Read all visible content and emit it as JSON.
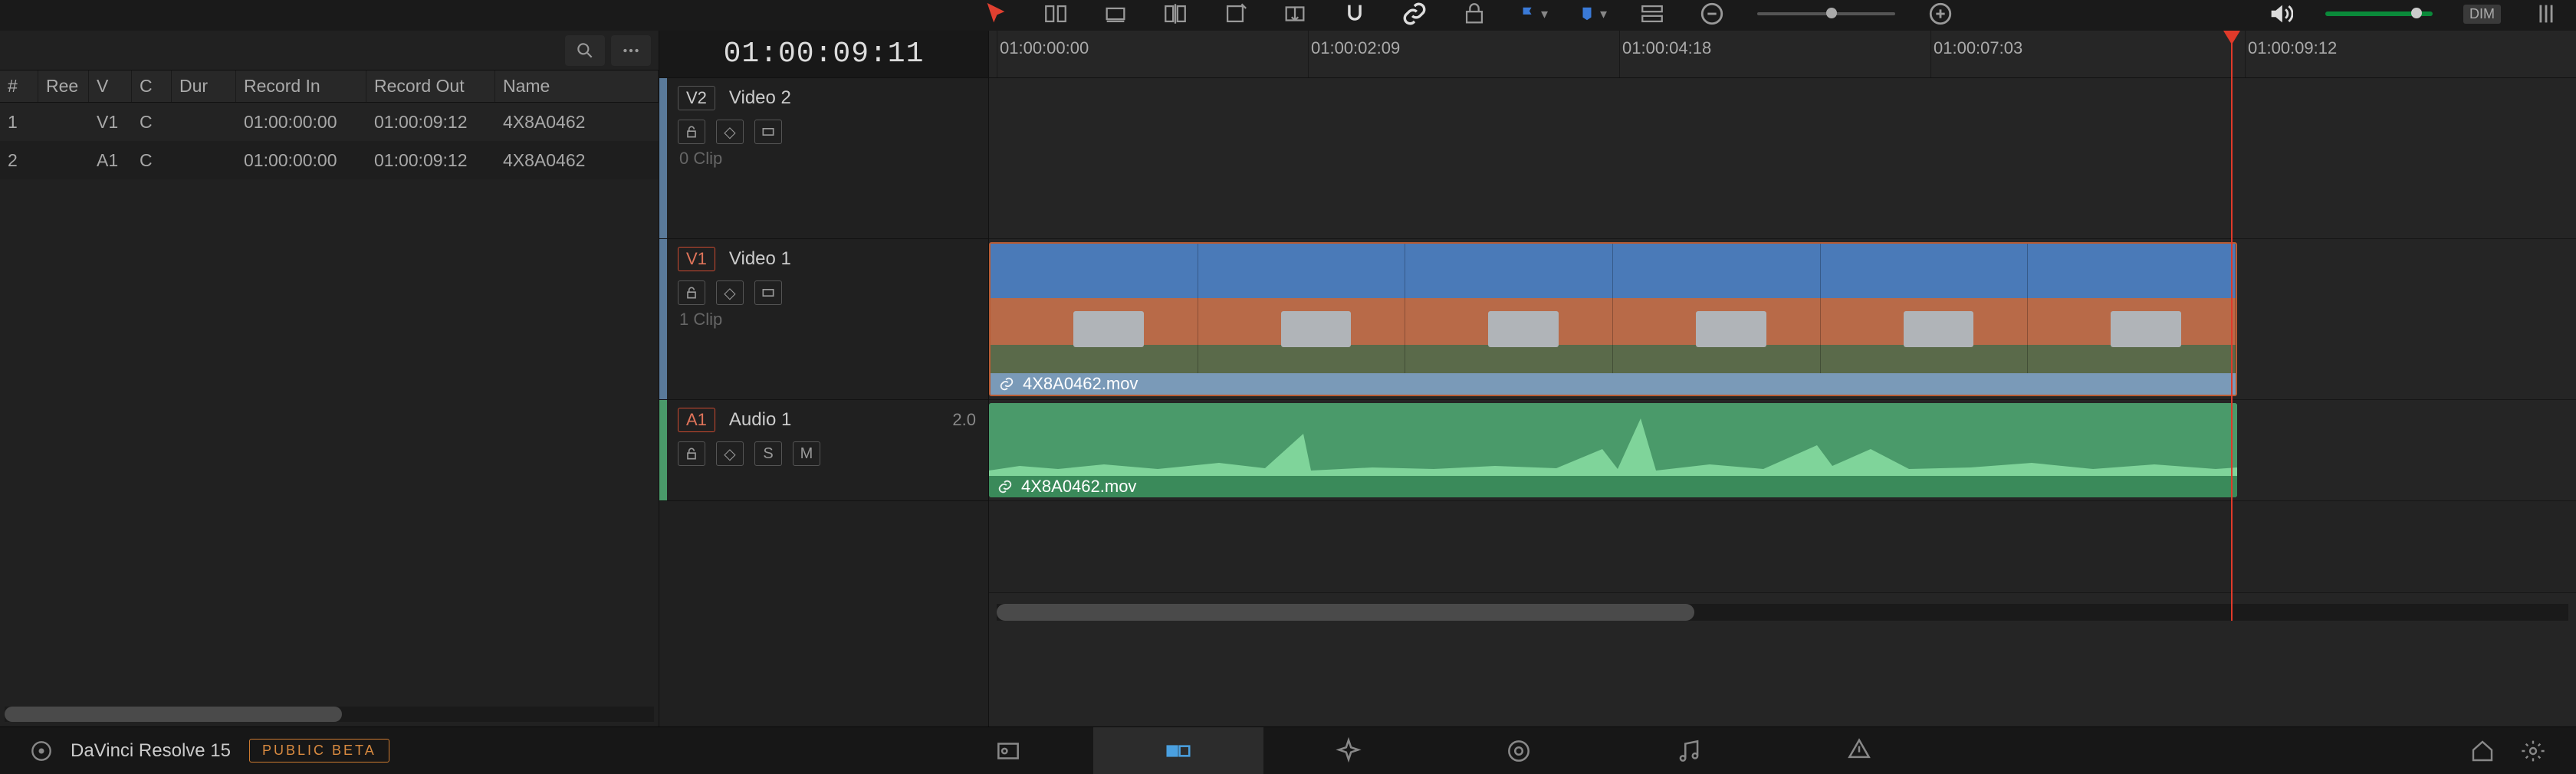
{
  "toolbar": {
    "dim_label": "DIM"
  },
  "timecode": "01:00:09:11",
  "ruler": {
    "ticks": [
      "01:00:00:00",
      "01:00:02:09",
      "01:00:04:18",
      "01:00:07:03",
      "01:00:09:12"
    ]
  },
  "table": {
    "headers": {
      "num": "#",
      "ree": "Ree",
      "v": "V",
      "c": "C",
      "dur": "Dur",
      "rin": "Record In",
      "rout": "Record Out",
      "name": "Name"
    },
    "rows": [
      {
        "num": "1",
        "ree": "",
        "v": "V1",
        "c": "C",
        "dur": "",
        "rin": "01:00:00:00",
        "rout": "01:00:09:12",
        "name": "4X8A0462"
      },
      {
        "num": "2",
        "ree": "",
        "v": "A1",
        "c": "C",
        "dur": "",
        "rin": "01:00:00:00",
        "rout": "01:00:09:12",
        "name": "4X8A0462"
      }
    ]
  },
  "tracks": {
    "v2": {
      "tag": "V2",
      "name": "Video 2",
      "clips": "0 Clip"
    },
    "v1": {
      "tag": "V1",
      "name": "Video 1",
      "clips": "1 Clip",
      "clip_name": "4X8A0462.mov"
    },
    "a1": {
      "tag": "A1",
      "name": "Audio 1",
      "level": "2.0",
      "solo": "S",
      "mute": "M",
      "clip_name": "4X8A0462.mov"
    }
  },
  "footer": {
    "app": "DaVinci Resolve 15",
    "beta": "PUBLIC BETA"
  }
}
